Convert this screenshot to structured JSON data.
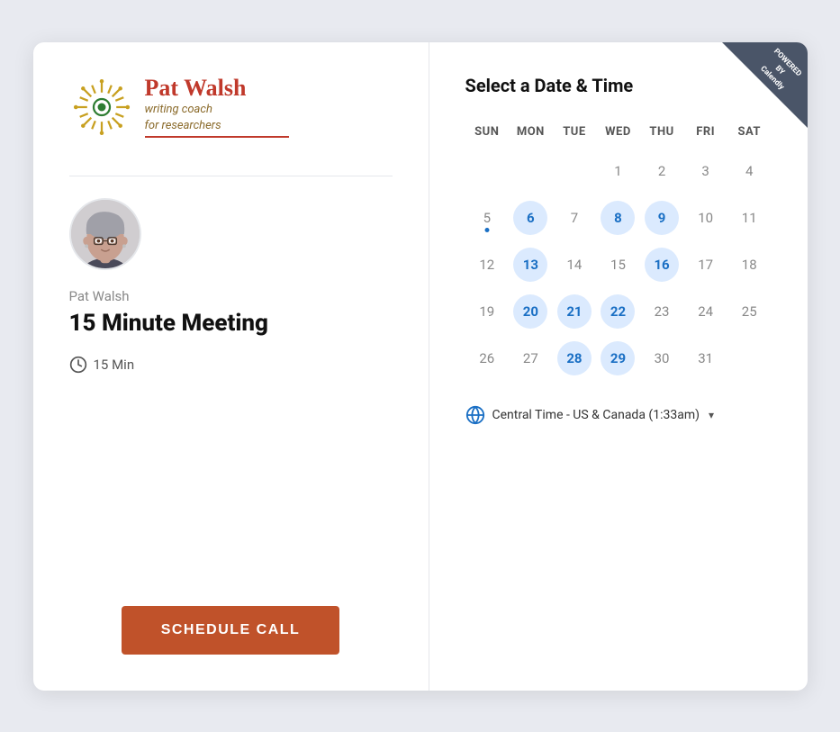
{
  "card": {
    "powered_by": "POWERED BY\nCalendly"
  },
  "left": {
    "logo_name": "Pat Walsh",
    "logo_tagline": "writing coach\nfor researchers",
    "host_name": "Pat Walsh",
    "meeting_title": "15 Minute Meeting",
    "duration": "15 Min",
    "schedule_button": "SCHEDULE CALL"
  },
  "right": {
    "heading": "Select a Date & Time",
    "calendar": {
      "day_headers": [
        "SUN",
        "MON",
        "TUE",
        "WED",
        "THU",
        "FRI",
        "SAT"
      ],
      "weeks": [
        [
          {
            "day": "",
            "type": "empty"
          },
          {
            "day": "",
            "type": "empty"
          },
          {
            "day": "",
            "type": "empty"
          },
          {
            "day": "1",
            "type": "normal"
          },
          {
            "day": "2",
            "type": "normal"
          },
          {
            "day": "3",
            "type": "normal"
          },
          {
            "day": "4",
            "type": "normal"
          }
        ],
        [
          {
            "day": "5",
            "type": "today-dot"
          },
          {
            "day": "6",
            "type": "available"
          },
          {
            "day": "7",
            "type": "normal"
          },
          {
            "day": "8",
            "type": "available"
          },
          {
            "day": "9",
            "type": "available"
          },
          {
            "day": "10",
            "type": "normal"
          },
          {
            "day": "11",
            "type": "normal"
          }
        ],
        [
          {
            "day": "12",
            "type": "normal"
          },
          {
            "day": "13",
            "type": "available"
          },
          {
            "day": "14",
            "type": "normal"
          },
          {
            "day": "15",
            "type": "normal"
          },
          {
            "day": "16",
            "type": "available"
          },
          {
            "day": "17",
            "type": "normal"
          },
          {
            "day": "18",
            "type": "normal"
          }
        ],
        [
          {
            "day": "19",
            "type": "normal"
          },
          {
            "day": "20",
            "type": "available"
          },
          {
            "day": "21",
            "type": "available"
          },
          {
            "day": "22",
            "type": "available"
          },
          {
            "day": "23",
            "type": "normal"
          },
          {
            "day": "24",
            "type": "normal"
          },
          {
            "day": "25",
            "type": "normal"
          }
        ],
        [
          {
            "day": "26",
            "type": "normal"
          },
          {
            "day": "27",
            "type": "normal"
          },
          {
            "day": "28",
            "type": "available"
          },
          {
            "day": "29",
            "type": "available"
          },
          {
            "day": "30",
            "type": "normal"
          },
          {
            "day": "31",
            "type": "normal"
          },
          {
            "day": "",
            "type": "empty"
          }
        ]
      ]
    },
    "timezone": "Central Time - US & Canada (1:33am)",
    "timezone_dropdown_arrow": "▾"
  }
}
